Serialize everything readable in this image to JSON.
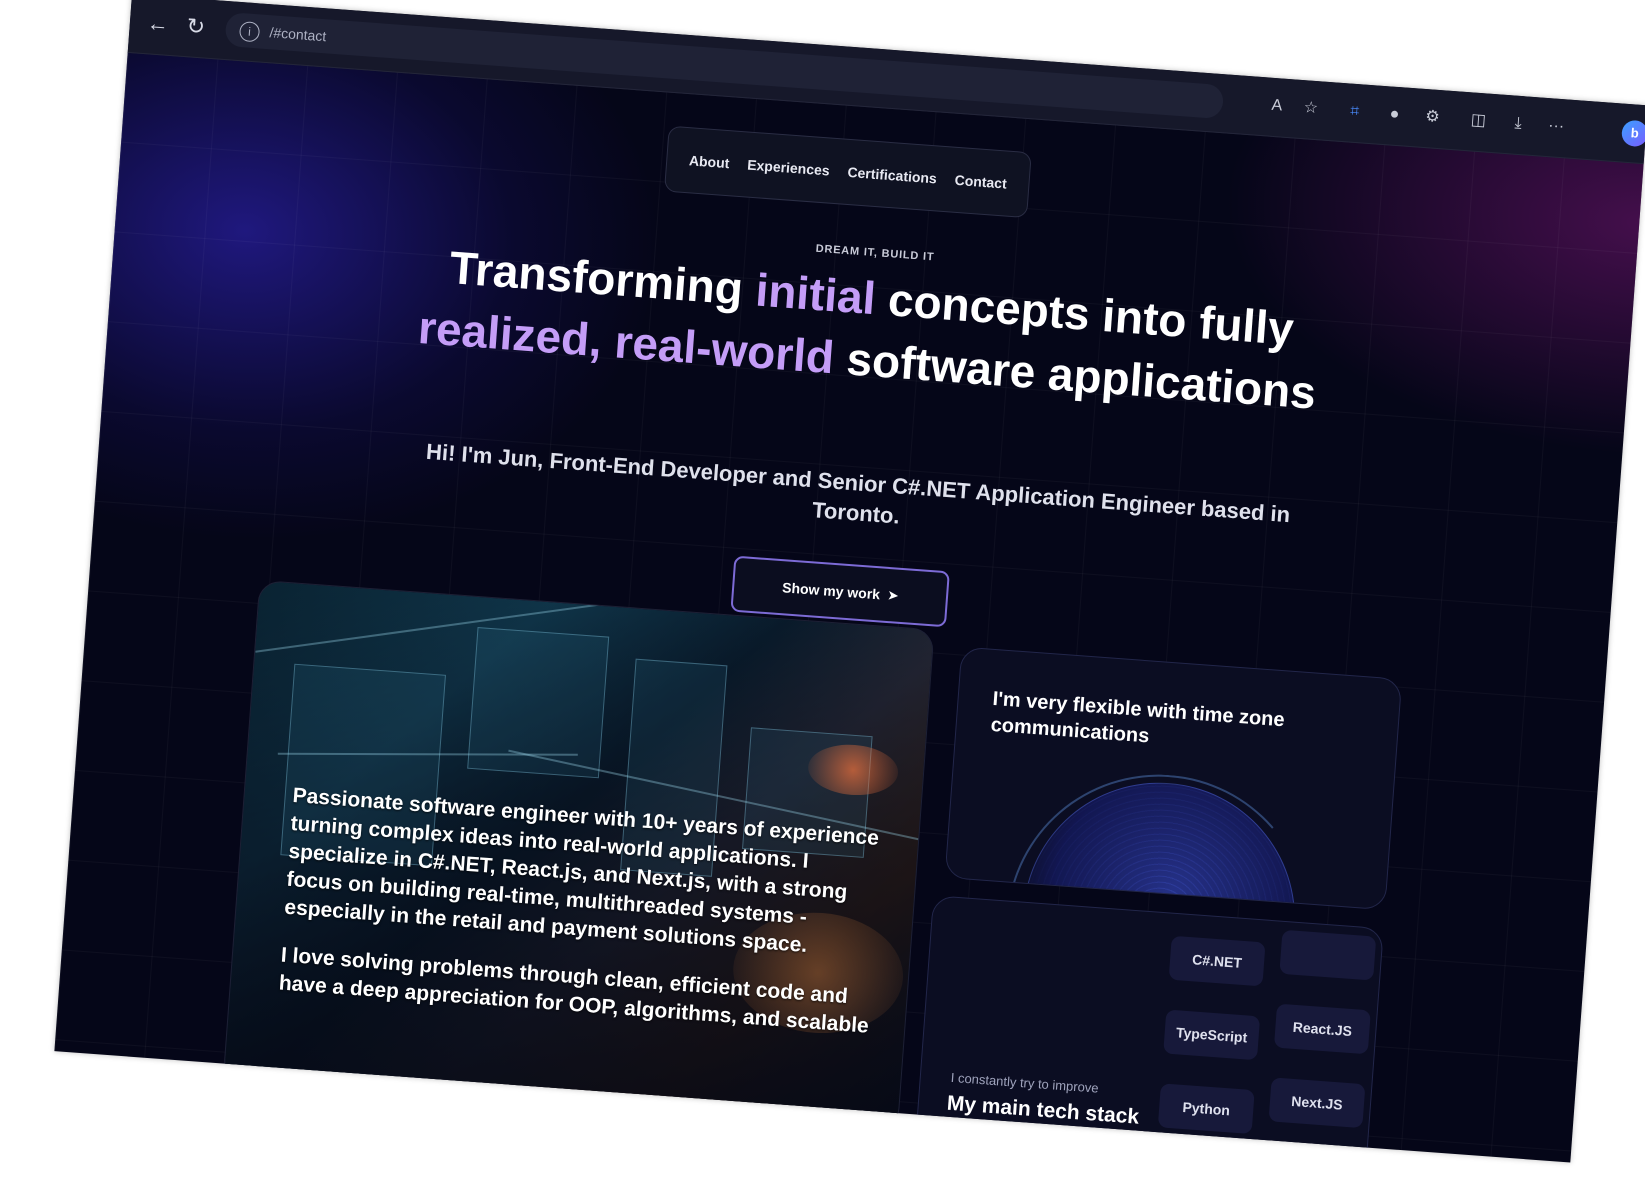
{
  "browser": {
    "url": "/#contact",
    "info_glyph": "i",
    "back_glyph": "←",
    "reload_glyph": "↻",
    "toolbar": {
      "read_aloud_glyph": "A",
      "favorite_glyph": "☆",
      "crop_glyph": "⌗",
      "ext1_glyph": "●",
      "ext2_glyph": "⚙",
      "split_glyph": "◫",
      "downloads_glyph": "⤓",
      "more_glyph": "···",
      "copilot_glyph": "b"
    }
  },
  "nav": {
    "items": [
      "About",
      "Experiences",
      "Certifications",
      "Contact"
    ]
  },
  "hero": {
    "tagline": "DREAM IT, BUILD IT",
    "headline_part1": "Transforming ",
    "headline_hl1": "initial",
    "headline_part2": " concepts into fully ",
    "headline_hl2": "realized, real-world",
    "headline_part3": " software applications",
    "subtitle": "Hi! I'm Jun, Front-End Developer and Senior C#.NET Application Engineer based in Toronto.",
    "cta_label": "Show my work",
    "cta_icon": "➤"
  },
  "intro_card": {
    "paragraph1": "Passionate software engineer with 10+ years of experience turning complex ideas into real-world applications. I specialize in C#.NET, React.js, and Next.js, with a strong focus on building real-time, multithreaded systems - especially in the retail and payment solutions space.",
    "paragraph2": "I love solving problems through clean, efficient code and have a deep appreciation for OOP, algorithms, and scalable"
  },
  "timezone_card": {
    "title": "I'm very flexible with time zone communications"
  },
  "tech_card": {
    "subtitle": "I constantly try to improve",
    "title": "My main tech stack",
    "chips_left": [
      "C#.NET",
      "TypeScript",
      "Python"
    ],
    "chips_right": [
      "",
      "React.JS",
      "Next.JS"
    ]
  },
  "colors": {
    "background": "#050618",
    "accent_purple": "#c49df7",
    "button_border": "#7d6bd6"
  }
}
